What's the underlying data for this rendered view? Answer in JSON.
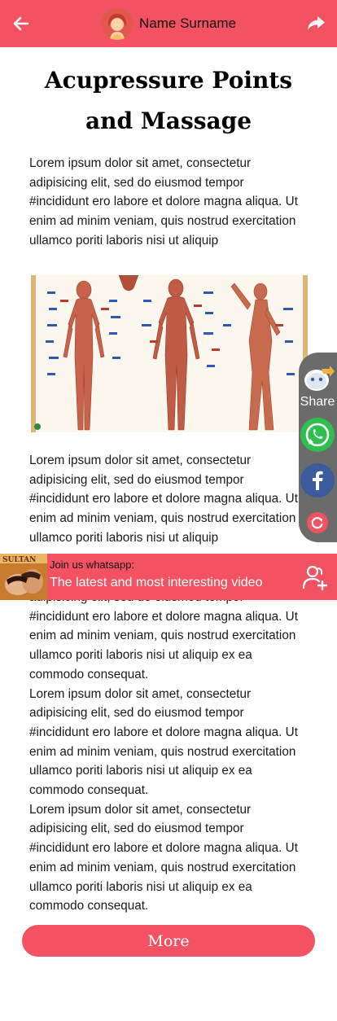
{
  "header": {
    "user_name": "Name Surname",
    "back_icon": "arrow-left-icon",
    "share_icon": "share-arrow-icon"
  },
  "article": {
    "title_line1": "Acupressure Points",
    "title_line2": "and  Massage",
    "paragraph_1": "Lorem ipsum dolor sit amet, consectetur adipisicing elit, sed do eiusmod tempor #incididunt ero labore et dolore magna aliqua. Ut enim ad minim veniam, quis nostrud exercitation ullamco poriti laboris nisi ut aliquip",
    "paragraph_2": "Lorem ipsum dolor sit amet, consectetur adipisicing elit, sed do eiusmod tempor #incididunt ero labore et dolore magna aliqua. Ut enim ad minim veniam, quis nostrud exercitation ullamco poriti laboris nisi ut aliquip",
    "stack_tail": "adipisicing elit, sed do eiusmod tempor #incididunt ero labore et dolore magna aliqua. Ut enim ad minim veniam, quis nostrud exercitation ullamco poriti laboris nisi ut aliquip ex ea commodo consequat.",
    "stack_full_1": "Lorem ipsum dolor sit amet, consectetur adipisicing elit, sed do eiusmod tempor #incididunt ero labore et dolore magna aliqua. Ut enim ad minim veniam, quis nostrud exercitation ullamco poriti laboris nisi ut aliquip ex ea commodo consequat.",
    "stack_full_2": "Lorem ipsum dolor sit amet, consectetur adipisicing elit, sed do eiusmod tempor #incididunt ero labore et dolore magna aliqua. Ut enim ad minim veniam, quis nostrud exercitation ullamco poriti laboris nisi ut aliquip ex ea commodo consequat."
  },
  "floating_share": {
    "label": "Share",
    "icons": [
      "share-icon",
      "whatsapp-icon",
      "facebook-icon",
      "refresh-icon"
    ]
  },
  "whatsapp_banner": {
    "join_text": "Join us whatsapp:",
    "message": "The latest and most interesting video",
    "thumbnail_text": "SULTAN"
  },
  "footer": {
    "more_label": "More"
  },
  "colors": {
    "accent": "#f35263",
    "panel_gray": "#6b6b6b",
    "whatsapp_green": "#2fbf4e",
    "facebook_blue": "#3b5b9c"
  }
}
